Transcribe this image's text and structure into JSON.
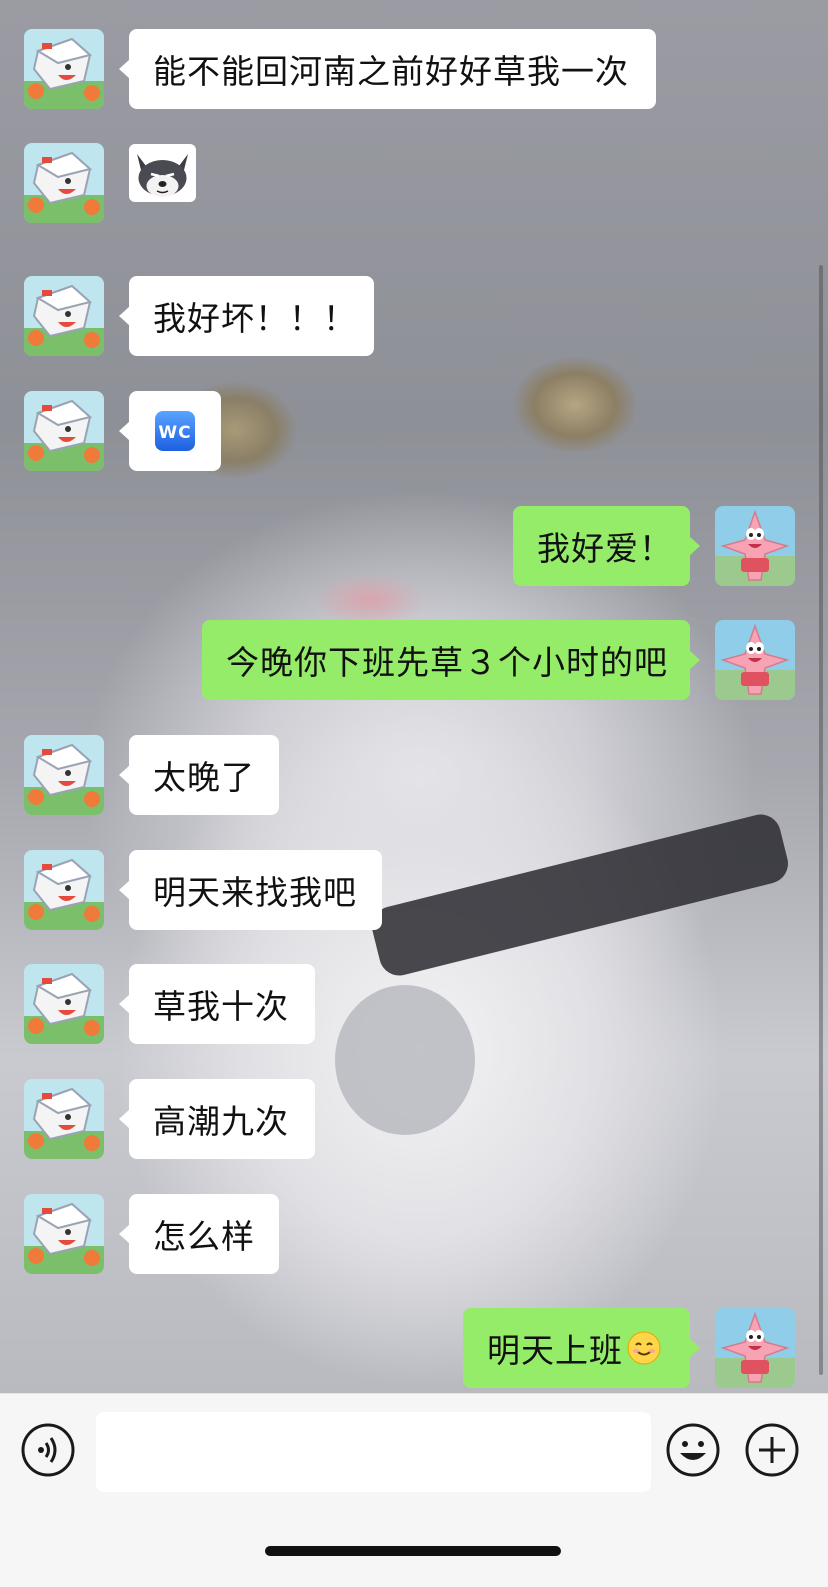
{
  "chat": {
    "messages": [
      {
        "side": "in",
        "text": "能不能回河南之前好好草我一次"
      },
      {
        "side": "in",
        "sticker": "husky-dog-face-sticker"
      },
      {
        "side": "in",
        "text": "我好坏！！！"
      },
      {
        "side": "in",
        "emoji": "wc-emoji",
        "emoji_text": "WC"
      },
      {
        "side": "out",
        "text": "我好爱！"
      },
      {
        "side": "out",
        "text": "今晚你下班先草３个小时的吧"
      },
      {
        "side": "in",
        "text": "太晚了"
      },
      {
        "side": "in",
        "text": "明天来找我吧"
      },
      {
        "side": "in",
        "text": "草我十次"
      },
      {
        "side": "in",
        "text": "高潮九次"
      },
      {
        "side": "in",
        "text": "怎么样"
      },
      {
        "side": "out",
        "text": "明天上班",
        "trailing_emoji": "smiling-face-emoji"
      }
    ],
    "incoming_avatar": "cartoon-box-character-avatar",
    "outgoing_avatar": "patrick-star-avatar"
  },
  "input_bar": {
    "voice_icon": "voice-icon",
    "text_value": "",
    "emoji_icon": "emoji-icon",
    "plus_icon": "plus-icon"
  },
  "colors": {
    "incoming_bubble": "#ffffff",
    "outgoing_bubble": "#95ec69",
    "input_bar_bg": "#f6f6f6"
  }
}
